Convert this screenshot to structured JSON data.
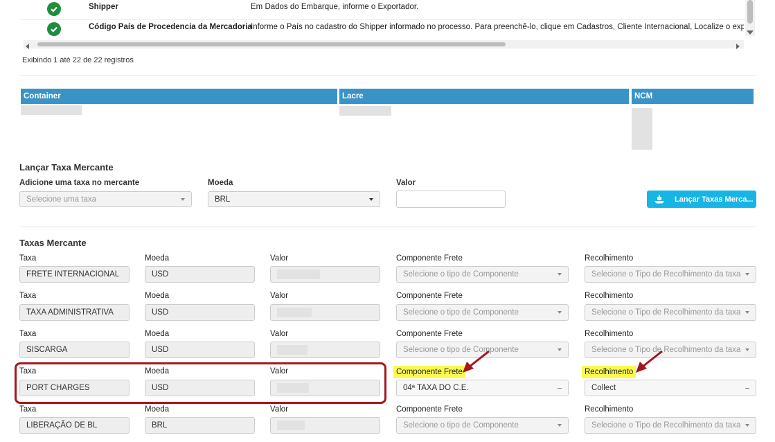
{
  "validation_rows": [
    {
      "name": "Shipper",
      "message": "Em Dados do Embarque, informe o Exportador."
    },
    {
      "name": "Código País de Procedencia da Mercadoria",
      "message": "Informe o País no cadastro do Shipper informado no processo. Para preenchê-lo, clique em Cadastros, Cliente Internacional, Localize o exp"
    }
  ],
  "records_info": "Exibindo 1 até 22 de 22 registros",
  "container_table": {
    "headers": [
      "Container",
      "Lacre",
      "NCM"
    ]
  },
  "lancar": {
    "title": "Lançar Taxa Mercante",
    "add_label": "Adicione uma taxa no mercante",
    "add_placeholder": "Selecione uma taxa",
    "moeda_label": "Moeda",
    "moeda_value": "BRL",
    "valor_label": "Valor",
    "valor_value": "",
    "button_label": "Lançar Taxas Merca..."
  },
  "taxas": {
    "title": "Taxas Mercante",
    "labels": {
      "taxa": "Taxa",
      "moeda": "Moeda",
      "valor": "Valor",
      "componente": "Componente Frete",
      "recolhimento": "Recolhimento"
    },
    "rows": [
      {
        "taxa": "FRETE INTERNACIONAL",
        "moeda": "USD",
        "componente": "Selecione o tipo de Componente",
        "recolhimento": "Selecione o Tipo de Recolhimento da taxa"
      },
      {
        "taxa": "TAXA ADMINISTRATIVA",
        "moeda": "USD",
        "componente": "Selecione o tipo de Componente",
        "recolhimento": "Selecione o Tipo de Recolhimento da taxa"
      },
      {
        "taxa": "SISCARGA",
        "moeda": "USD",
        "componente": "Selecione o tipo de Componente",
        "recolhimento": "Selecione o Tipo de Recolhimento da taxa"
      },
      {
        "taxa": "PORT CHARGES",
        "moeda": "USD",
        "componente": "04ª TAXA DO C.E.",
        "recolhimento": "Collect"
      },
      {
        "taxa": "LIBERAÇÃO DE BL",
        "moeda": "BRL",
        "componente": "Selecione o tipo de Componente",
        "recolhimento": "Selecione o Tipo de Recolhimento da taxa"
      }
    ]
  },
  "colors": {
    "header_blue": "#3a93c6",
    "button_cyan": "#17b4e6",
    "highlight_yellow": "#fbf94f",
    "annotation_red": "#a5161b"
  }
}
